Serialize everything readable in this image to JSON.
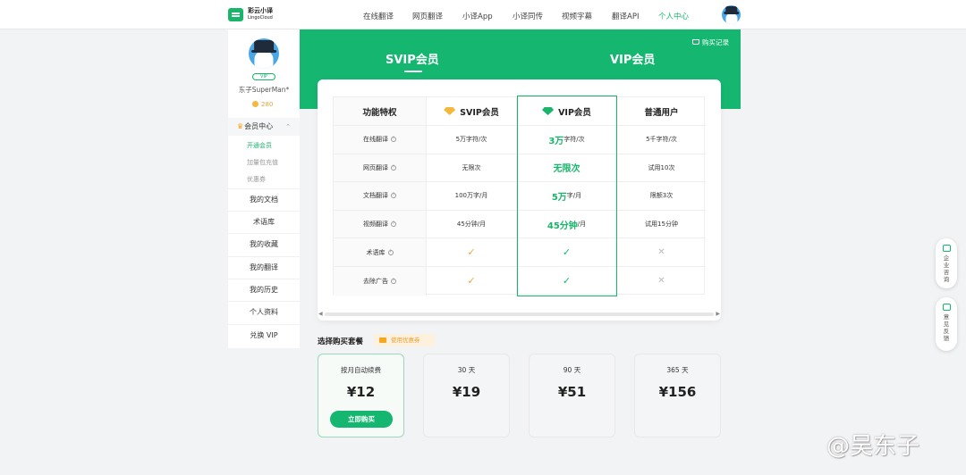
{
  "header": {
    "logo_cn": "彩云小译",
    "logo_en": "LingoCloud",
    "nav": [
      "在线翻译",
      "网页翻译",
      "小译App",
      "小译同传",
      "视频字幕",
      "翻译API",
      "个人中心"
    ],
    "active_nav": "个人中心"
  },
  "sidebar": {
    "vip_badge": "VIP",
    "username": "东子SuperMan*",
    "coins": "280",
    "member_center": "会员中心",
    "sub_items": [
      "开通会员",
      "加量包充值",
      "优惠券"
    ],
    "items": [
      "我的文档",
      "术语库",
      "我的收藏",
      "我的翻译",
      "我的历史",
      "个人资料",
      "兑换 VIP"
    ]
  },
  "banner": {
    "purchase_record": "购买记录",
    "tabs": [
      "SVIP会员",
      "VIP会员"
    ],
    "active_tab": "SVIP会员"
  },
  "table": {
    "headers": [
      "功能特权",
      "SVIP会员",
      "VIP会员",
      "普通用户"
    ],
    "rows": [
      {
        "feature": "在线翻译",
        "svip": "5万字符/次",
        "vip_value": "3万",
        "vip_unit": "字符/次",
        "normal": "5千字符/次"
      },
      {
        "feature": "网页翻译",
        "svip": "无限次",
        "vip_value": "无限次",
        "vip_unit": "",
        "normal": "试用10次"
      },
      {
        "feature": "文档翻译",
        "svip": "100万字/月",
        "vip_value": "5万",
        "vip_unit": "字/月",
        "normal": "限额3次"
      },
      {
        "feature": "视频翻译",
        "svip": "45分钟/月",
        "vip_value": "45分钟",
        "vip_unit": "/月",
        "normal": "试用15分钟"
      },
      {
        "feature": "术语库",
        "svip": "✓",
        "vip_value": "✓",
        "vip_unit": "",
        "normal": "✕"
      },
      {
        "feature": "去除广告",
        "svip": "✓",
        "vip_value": "✓",
        "vip_unit": "",
        "normal": "✕"
      }
    ]
  },
  "packages": {
    "section_title": "选择购买套餐",
    "coupon_label": "使用优惠券",
    "items": [
      {
        "name": "按月自动续费",
        "price": "¥12"
      },
      {
        "name": "30 天",
        "price": "¥19"
      },
      {
        "name": "90 天",
        "price": "¥51"
      },
      {
        "name": "365 天",
        "price": "¥156"
      }
    ],
    "buy_button": "立即购买"
  },
  "float_buttons": [
    "企业咨询",
    "意见反馈"
  ],
  "watermark": "@吴东子",
  "colors": {
    "brand_green": "#14b670",
    "gold": "#f5b83d",
    "background": "#f2f3f5"
  }
}
